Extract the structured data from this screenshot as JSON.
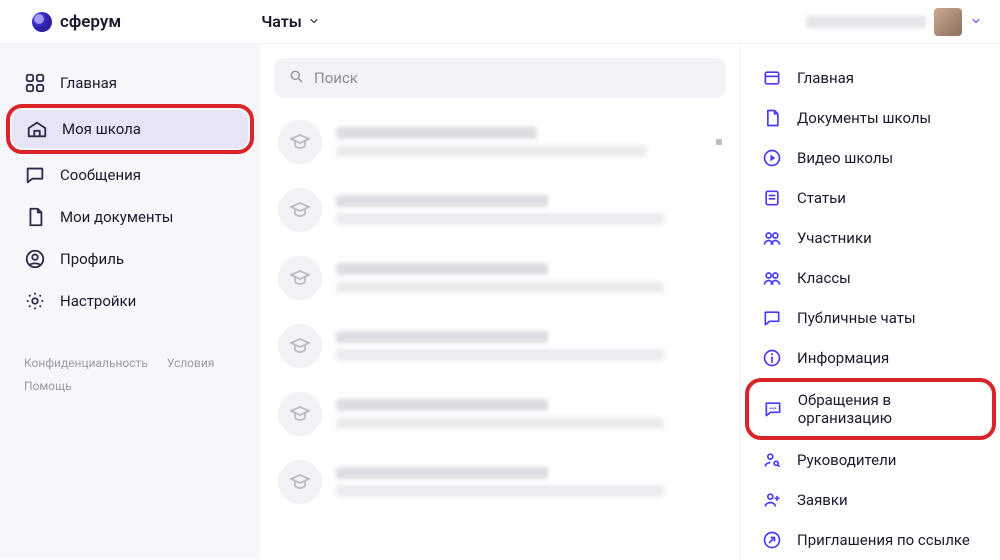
{
  "header": {
    "brand": "сферум",
    "chats_label": "Чаты"
  },
  "sidebar": {
    "items": [
      {
        "id": "home",
        "label": "Главная"
      },
      {
        "id": "school",
        "label": "Моя школа"
      },
      {
        "id": "messages",
        "label": "Сообщения"
      },
      {
        "id": "docs",
        "label": "Мои документы"
      },
      {
        "id": "profile",
        "label": "Профиль"
      },
      {
        "id": "settings",
        "label": "Настройки"
      }
    ],
    "selected": "school"
  },
  "legal": {
    "privacy": "Конфиденциальность",
    "terms": "Условия",
    "help": "Помощь"
  },
  "search": {
    "placeholder": "Поиск"
  },
  "chats": [
    {
      "has_pin": true
    },
    {
      "has_pin": false
    },
    {
      "has_pin": false
    },
    {
      "has_pin": false
    },
    {
      "has_pin": false
    },
    {
      "has_pin": false
    }
  ],
  "right_menu": {
    "group1": [
      {
        "id": "home2",
        "label": "Главная",
        "icon": "window"
      },
      {
        "id": "sdocs",
        "label": "Документы школы",
        "icon": "doc"
      },
      {
        "id": "video",
        "label": "Видео школы",
        "icon": "play"
      },
      {
        "id": "articles",
        "label": "Статьи",
        "icon": "article"
      }
    ],
    "group2": [
      {
        "id": "members",
        "label": "Участники",
        "icon": "people"
      },
      {
        "id": "classes",
        "label": "Классы",
        "icon": "people"
      },
      {
        "id": "pubchats",
        "label": "Публичные чаты",
        "icon": "chat-bubble"
      }
    ],
    "group3": [
      {
        "id": "info",
        "label": "Информация",
        "icon": "info"
      },
      {
        "id": "appeals",
        "label": "Обращения в организацию",
        "icon": "chat-dots"
      },
      {
        "id": "leaders",
        "label": "Руководители",
        "icon": "person-key"
      },
      {
        "id": "requests",
        "label": "Заявки",
        "icon": "person-plus"
      },
      {
        "id": "invites",
        "label": "Приглашения по ссылке",
        "icon": "link-arrow"
      }
    ],
    "highlighted": "appeals"
  }
}
